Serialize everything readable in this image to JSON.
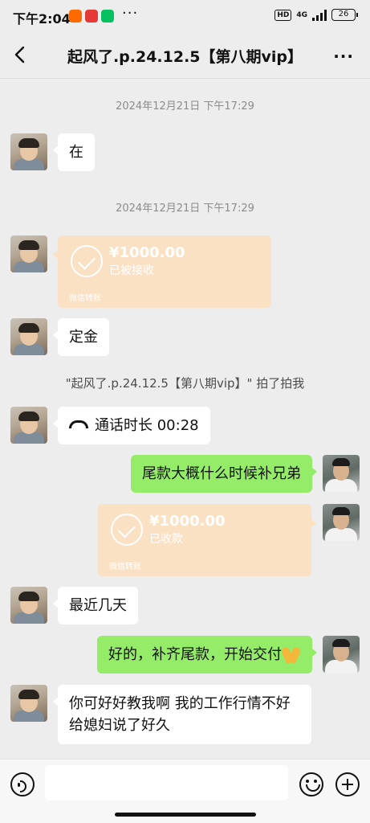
{
  "status_bar": {
    "time": "下午2:04",
    "network": "4G",
    "battery": "26",
    "hd": "HD",
    "app_icons": [
      "xiaomi-icon",
      "app-icon",
      "wechat-icon"
    ],
    "more": "···"
  },
  "header": {
    "title": "起风了.p.24.12.5【第八期vip】",
    "back_icon": "back-chevron-icon",
    "more_icon": "···"
  },
  "messages": [
    {
      "type": "timestamp",
      "text": "2024年12月21日 下午17:29"
    },
    {
      "type": "text",
      "side": "left",
      "text": "在"
    },
    {
      "type": "timestamp",
      "text": "2024年12月21日 下午17:29"
    },
    {
      "type": "transfer",
      "side": "left",
      "amount": "¥1000.00",
      "status": "已被接收",
      "source": "微信转账"
    },
    {
      "type": "text",
      "side": "left",
      "text": "定金"
    },
    {
      "type": "system",
      "text": "\"起风了.p.24.12.5【第八期vip】\" 拍了拍我"
    },
    {
      "type": "call",
      "side": "left",
      "text": "通话时长 00:28"
    },
    {
      "type": "text",
      "side": "right",
      "text": "尾款大概什么时候补兄弟"
    },
    {
      "type": "transfer",
      "side": "right",
      "amount": "¥1000.00",
      "status": "已收款",
      "source": "微信转账"
    },
    {
      "type": "text",
      "side": "left",
      "text": "最近几天"
    },
    {
      "type": "text",
      "side": "right",
      "text": "好的，补齐尾款，开始交付",
      "emoji": "folded-hands-emoji"
    },
    {
      "type": "text",
      "side": "left",
      "text": "你可好好教我啊 我的工作行情不好 给媳妇说了好久"
    }
  ],
  "input_bar": {
    "voice_icon": "voice-icon",
    "text_value": "",
    "emoji_icon": "emoji-icon",
    "plus_icon": "plus-icon"
  },
  "colors": {
    "background": "#ededed",
    "bubble_self": "#95ec69",
    "bubble_other": "#ffffff",
    "transfer": "#fbe1c4",
    "timestamp": "#8b8b8b"
  }
}
